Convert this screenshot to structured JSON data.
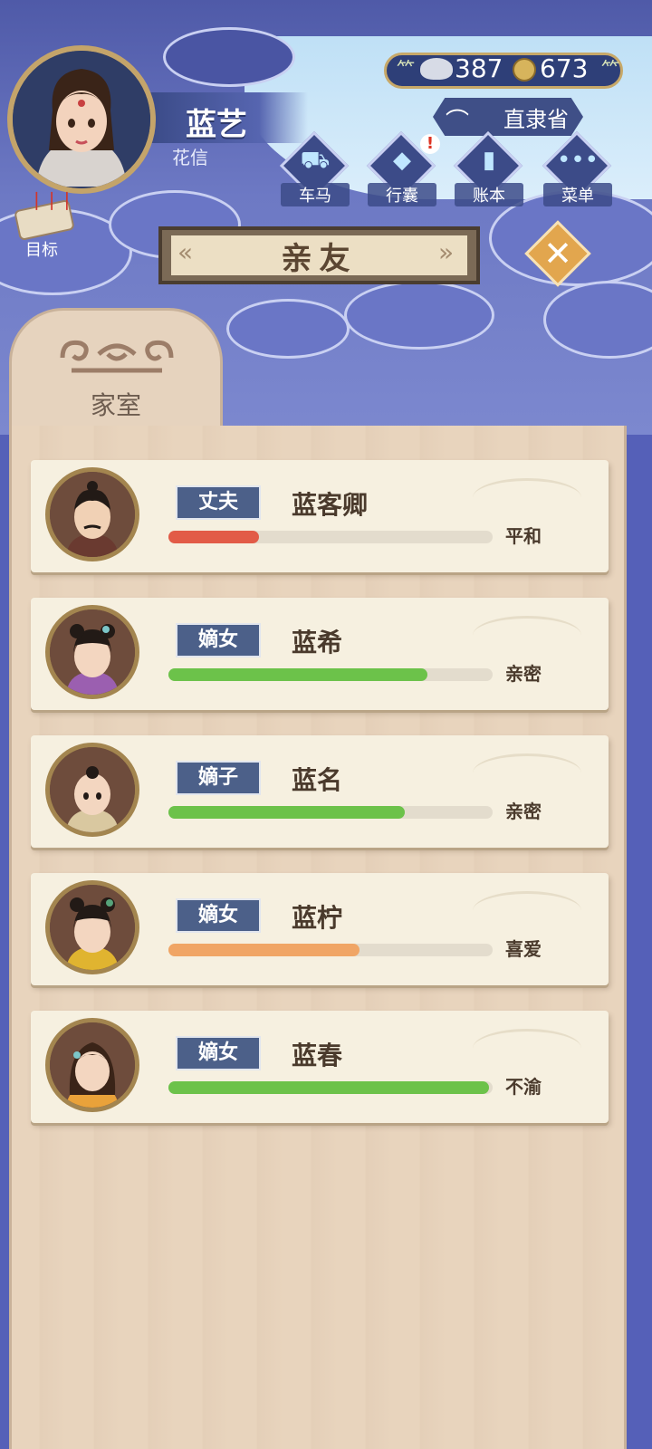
{
  "player": {
    "name": "蓝艺",
    "subtitle": "花信"
  },
  "currency": {
    "silver": "387",
    "coins": "673"
  },
  "location": "直隶省",
  "menu": [
    {
      "label": "车马",
      "icon": "carriage-icon",
      "glyph": "⛟",
      "alert": ""
    },
    {
      "label": "行囊",
      "icon": "bag-icon",
      "glyph": "◆",
      "alert": "!"
    },
    {
      "label": "账本",
      "icon": "ledger-icon",
      "glyph": "▮",
      "alert": ""
    },
    {
      "label": "菜单",
      "icon": "more-icon",
      "glyph": "•••",
      "alert": ""
    }
  ],
  "goal_label": "目标",
  "title": "亲友",
  "close_glyph": "✕",
  "tab_label": "家室",
  "members": [
    {
      "role": "丈夫",
      "name": "蓝客卿",
      "relation": "平和",
      "affinity": 0.28,
      "color": "#e25b47"
    },
    {
      "role": "嫡女",
      "name": "蓝希",
      "relation": "亲密",
      "affinity": 0.8,
      "color": "#6cc24a"
    },
    {
      "role": "嫡子",
      "name": "蓝名",
      "relation": "亲密",
      "affinity": 0.73,
      "color": "#6cc24a"
    },
    {
      "role": "嫡女",
      "name": "蓝柠",
      "relation": "喜爱",
      "affinity": 0.59,
      "color": "#f0a565"
    },
    {
      "role": "嫡女",
      "name": "蓝春",
      "relation": "不渝",
      "affinity": 0.99,
      "color": "#6cc24a"
    }
  ]
}
